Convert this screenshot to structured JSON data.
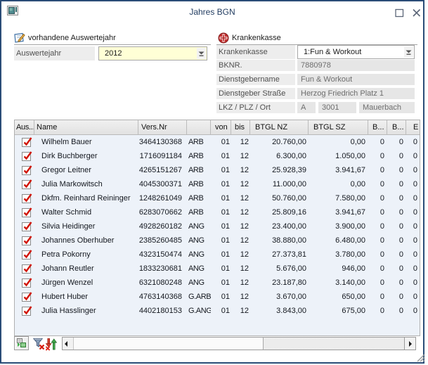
{
  "window": {
    "title": "Jahres BGN"
  },
  "left_panel": {
    "header": "vorhandene Auswertejahr",
    "year_label": "Auswertejahr",
    "year_value": "2012"
  },
  "right_panel": {
    "header": "Krankenkasse",
    "kasse_label": "Krankenkasse",
    "kasse_value": "1:Fun & Workout",
    "bknr_label": "BKNR.",
    "bknr_value": "7880978",
    "dgname_label": "Dienstgebername",
    "dgname_value": "Fun & Workout",
    "dgstrasse_label": "Dienstgeber Straße",
    "dgstrasse_value": "Herzog Friedrich Platz 1",
    "lkz_label": "LKZ / PLZ / Ort",
    "lkz_value": "A",
    "plz_value": "3001",
    "ort_value": "Mauerbach"
  },
  "table": {
    "columns": [
      "Aus...",
      "Name",
      "Vers.Nr",
      "",
      "von",
      "bis",
      "BTGL NZ",
      "BTGL SZ",
      "B...",
      "B...",
      "E"
    ],
    "rows": [
      {
        "checked": true,
        "name": "Wilhelm Bauer",
        "versnr": "3464130368",
        "type": "ARB",
        "von": "01",
        "bis": "12",
        "btgl_nz": "20.760,00",
        "btgl_sz": "0,00",
        "b1": "0",
        "b2": "0",
        "b3": "0"
      },
      {
        "checked": true,
        "name": "Dirk Buchberger",
        "versnr": "1716091184",
        "type": "ARB",
        "von": "01",
        "bis": "12",
        "btgl_nz": "6.300,00",
        "btgl_sz": "1.050,00",
        "b1": "0",
        "b2": "0",
        "b3": "0"
      },
      {
        "checked": true,
        "name": "Gregor Leitner",
        "versnr": "4265151267",
        "type": "ARB",
        "von": "01",
        "bis": "12",
        "btgl_nz": "25.928,39",
        "btgl_sz": "3.941,67",
        "b1": "0",
        "b2": "0",
        "b3": "0"
      },
      {
        "checked": true,
        "name": "Julia Markowitsch",
        "versnr": "4045300371",
        "type": "ARB",
        "von": "01",
        "bis": "12",
        "btgl_nz": "11.000,00",
        "btgl_sz": "0,00",
        "b1": "0",
        "b2": "0",
        "b3": "0"
      },
      {
        "checked": true,
        "name": "Dkfm. Reinhard Reininger",
        "versnr": "1248261049",
        "type": "ARB",
        "von": "01",
        "bis": "12",
        "btgl_nz": "50.760,00",
        "btgl_sz": "7.580,00",
        "b1": "0",
        "b2": "0",
        "b3": "0"
      },
      {
        "checked": true,
        "name": "Walter Schmid",
        "versnr": "6283070662",
        "type": "ARB",
        "von": "01",
        "bis": "12",
        "btgl_nz": "25.809,16",
        "btgl_sz": "3.941,67",
        "b1": "0",
        "b2": "0",
        "b3": "0"
      },
      {
        "checked": true,
        "name": "Silvia Heidinger",
        "versnr": "4928260182",
        "type": "ANG",
        "von": "01",
        "bis": "12",
        "btgl_nz": "23.400,00",
        "btgl_sz": "3.900,00",
        "b1": "0",
        "b2": "0",
        "b3": "0"
      },
      {
        "checked": true,
        "name": "Johannes Oberhuber",
        "versnr": "2385260485",
        "type": "ANG",
        "von": "01",
        "bis": "12",
        "btgl_nz": "38.880,00",
        "btgl_sz": "6.480,00",
        "b1": "0",
        "b2": "0",
        "b3": "0"
      },
      {
        "checked": true,
        "name": "Petra Pokorny",
        "versnr": "4323150474",
        "type": "ANG",
        "von": "01",
        "bis": "12",
        "btgl_nz": "27.373,81",
        "btgl_sz": "3.780,00",
        "b1": "0",
        "b2": "0",
        "b3": "0"
      },
      {
        "checked": true,
        "name": "Johann Reutler",
        "versnr": "1833230681",
        "type": "ANG",
        "von": "01",
        "bis": "12",
        "btgl_nz": "5.676,00",
        "btgl_sz": "946,00",
        "b1": "0",
        "b2": "0",
        "b3": "0"
      },
      {
        "checked": true,
        "name": "Jürgen Wenzel",
        "versnr": "6321080248",
        "type": "ANG",
        "von": "01",
        "bis": "12",
        "btgl_nz": "23.187,80",
        "btgl_sz": "3.140,00",
        "b1": "0",
        "b2": "0",
        "b3": "0"
      },
      {
        "checked": true,
        "name": "Hubert Huber",
        "versnr": "4763140368",
        "type": "G.ARB",
        "von": "01",
        "bis": "12",
        "btgl_nz": "3.670,00",
        "btgl_sz": "650,00",
        "b1": "0",
        "b2": "0",
        "b3": "0"
      },
      {
        "checked": true,
        "name": "Julia Hasslinger",
        "versnr": "4402180153",
        "type": "G.ANG",
        "von": "01",
        "bis": "12",
        "btgl_nz": "3.843,00",
        "btgl_sz": "675,00",
        "b1": "0",
        "b2": "0",
        "b3": "0"
      }
    ]
  },
  "toolbar": {
    "icons": [
      "transfer-icon",
      "filter-delete-icon",
      "sort-arrows-icon"
    ]
  },
  "colors": {
    "window_border": "#2a4c77",
    "title_text": "#1f3a5f",
    "combo_yellow": "#ffffd6",
    "readonly_bg": "#e6e6e6",
    "table_bg": "#edf2f9",
    "check_red": "#d11507"
  }
}
